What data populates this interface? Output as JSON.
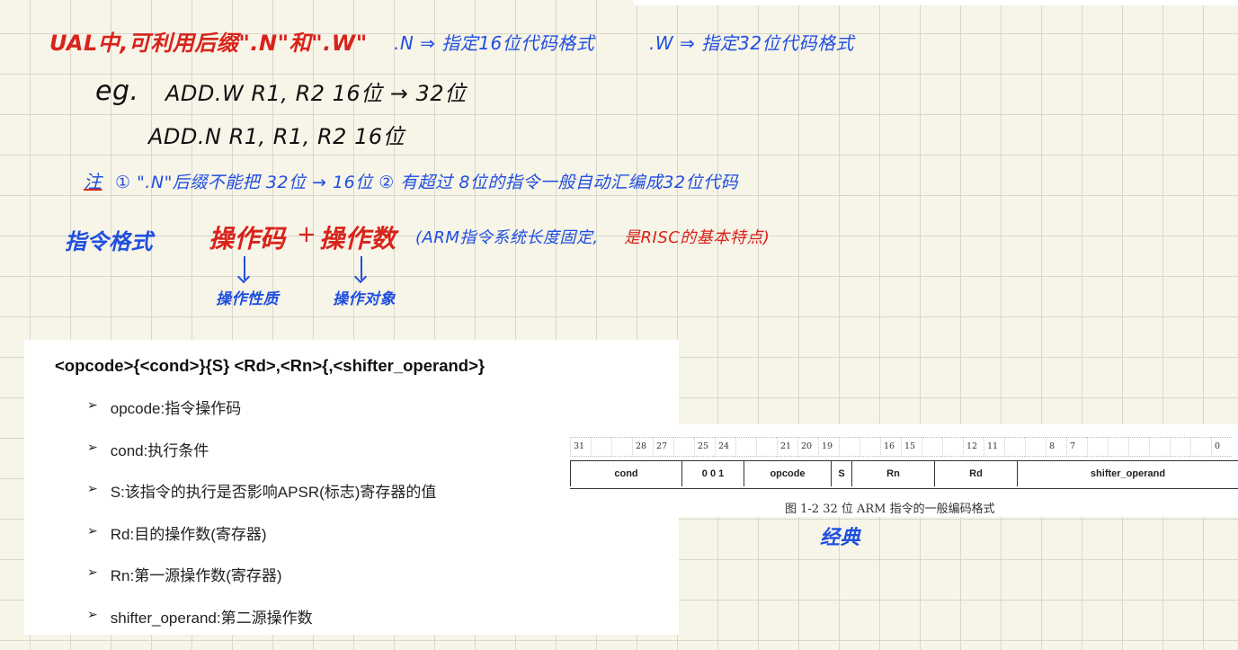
{
  "notes": {
    "line1_red": "UAL中,可利用后缀\".N\"和\".W\"",
    "line1_blue_n": ".N ⇒ 指定16位代码格式",
    "line1_blue_w": ".W ⇒ 指定32位代码格式",
    "eg_label": "eg.",
    "eg_line1": "ADD.W   R1, R2     16位 → 32位",
    "eg_line2": "ADD.N   R1, R1, R2   16位",
    "note_label": "注",
    "note_text": "① \".N\"后缀不能把 32位 → 16位   ② 有超过 8位的指令一般自动汇编成32位代码",
    "fmt_label": "指令格式",
    "opcode_word": "操作码",
    "plus": "+",
    "operand_word": "操作数",
    "paren_blue": "(ARM指令系统长度固定,",
    "paren_red": "是RISC的基本特点)",
    "opcode_note": "操作性质",
    "operand_note": "操作对象",
    "classic": "经典"
  },
  "doc": {
    "format_line": "<opcode>{<cond>}{S} <Rd>,<Rn>{,<shifter_operand>}",
    "bullet_marker": "➢",
    "items": [
      "opcode:指令操作码",
      "cond:执行条件",
      "S:该指令的执行是否影响APSR(标志)寄存器的值",
      "Rd:目的操作数(寄存器)",
      "Rn:第一源操作数(寄存器)",
      "shifter_operand:第二源操作数"
    ]
  },
  "figure": {
    "bit_labels": [
      "31",
      "",
      "",
      "28",
      "27",
      "",
      "25",
      "24",
      "",
      "",
      "21",
      "20",
      "19",
      "",
      "",
      "16",
      "15",
      "",
      "",
      "12",
      "11",
      "",
      "",
      "8",
      "7",
      "",
      "",
      "",
      "",
      "",
      "",
      "0"
    ],
    "fields": [
      "cond",
      "0  0  1",
      "opcode",
      "S",
      "Rn",
      "Rd",
      "shifter_operand"
    ],
    "caption": "图 1-2   32 位 ARM 指令的一般编码格式"
  }
}
